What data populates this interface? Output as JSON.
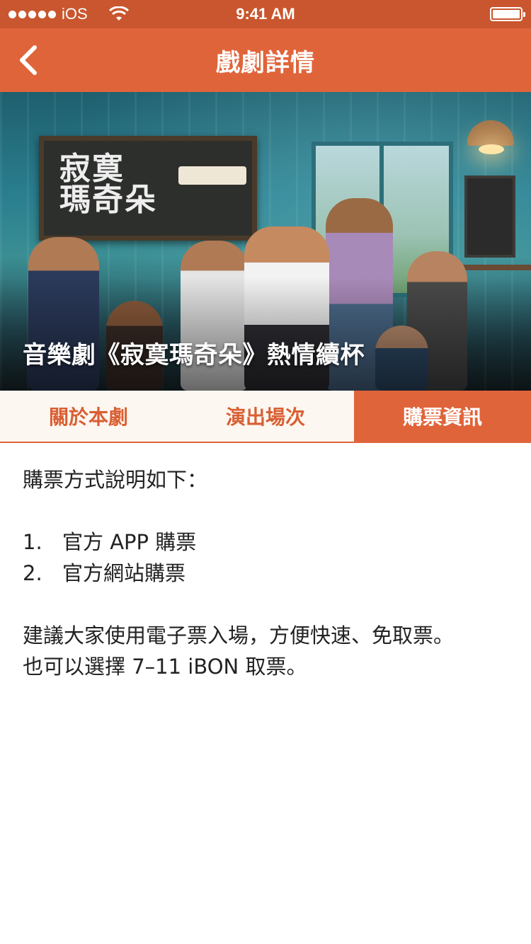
{
  "status_bar": {
    "carrier": "iOS",
    "time": "9:41 AM"
  },
  "nav": {
    "title": "戲劇詳情"
  },
  "hero": {
    "caption": "音樂劇《寂寞瑪奇朵》熱情續杯",
    "chalkboard_title_line1": "寂寞",
    "chalkboard_title_line2": "瑪奇朵"
  },
  "tabs": [
    {
      "label": "關於本劇",
      "active": false
    },
    {
      "label": "演出場次",
      "active": false
    },
    {
      "label": "購票資訊",
      "active": true
    }
  ],
  "content": {
    "intro": "購票方式說明如下：",
    "methods": [
      {
        "num": "1.",
        "text": "官方 APP 購票"
      },
      {
        "num": "2.",
        "text": "官方網站購票"
      }
    ],
    "note_line1": "建議大家使用電子票入場，方便快速、免取票。",
    "note_line2": "也可以選擇 7–11 iBON 取票。"
  },
  "colors": {
    "accent": "#e0643a",
    "status_bar": "#c9562e",
    "tab_background": "#fdf7f1"
  }
}
